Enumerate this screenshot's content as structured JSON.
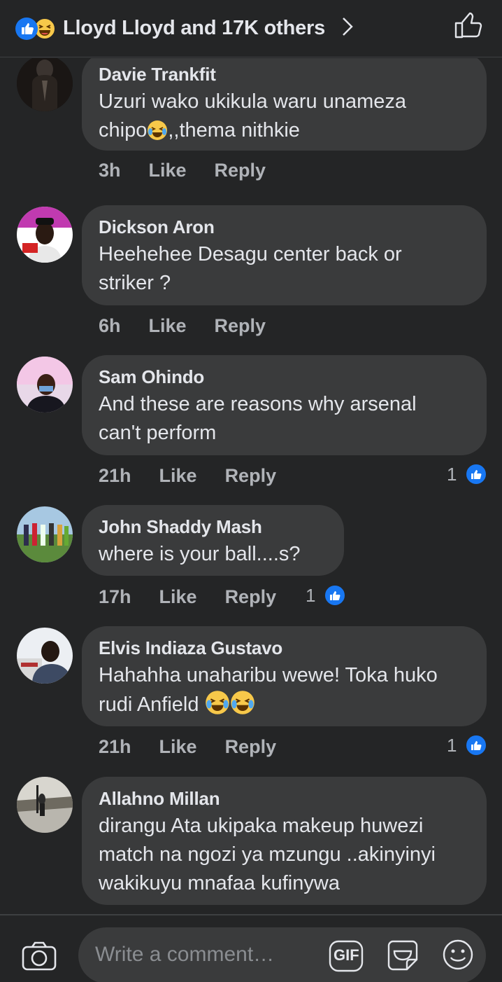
{
  "header": {
    "title": "Lloyd Lloyd and 17K others"
  },
  "comments": [
    {
      "author": "Davie Trankfit",
      "text_line1": "Uzuri wako ukikula waru unameza",
      "text_line2_a": "chipo",
      "text_line2_b": ",,thema nithkie",
      "time": "3h",
      "like": "Like",
      "reply": "Reply"
    },
    {
      "author": "Dickson Aron",
      "text_line1": "Heehehee Desagu center back or",
      "text_line2": "striker ?",
      "time": "6h",
      "like": "Like",
      "reply": "Reply"
    },
    {
      "author": "Sam Ohindo",
      "text_line1": "And these are reasons why arsenal",
      "text_line2": "can't perform",
      "time": "21h",
      "like": "Like",
      "reply": "Reply",
      "likes": "1"
    },
    {
      "author": "John Shaddy Mash",
      "text_line1": "where is your ball....s?",
      "time": "17h",
      "like": "Like",
      "reply": "Reply",
      "likes": "1"
    },
    {
      "author": "Elvis Indiaza Gustavo",
      "text_line1": "Hahahha unaharibu wewe! Toka huko",
      "text_line2": "rudi Anfield",
      "time": "21h",
      "like": "Like",
      "reply": "Reply",
      "likes": "1"
    },
    {
      "author": "Allahno Millan",
      "text_line1": "dirangu Ata ukipaka makeup huwezi",
      "text_line2": "match na ngozi ya mzungu ..akinyinyi",
      "text_line3": "wakikuyu mnafaa kufinywa"
    }
  ],
  "composer": {
    "placeholder": "Write a comment…",
    "gif_label": "GIF"
  },
  "colors": {
    "background": "#242526",
    "bubble": "#3a3b3c",
    "accent": "#1877f2",
    "text": "#e4e6eb",
    "muted": "#b0b3b8"
  },
  "icons": [
    "like-reaction-icon",
    "haha-reaction-icon",
    "chevron-right-icon",
    "thumbs-up-outline-icon",
    "camera-icon",
    "gif-icon",
    "sticker-icon",
    "emoji-icon",
    "crying-laughing-emoji"
  ]
}
